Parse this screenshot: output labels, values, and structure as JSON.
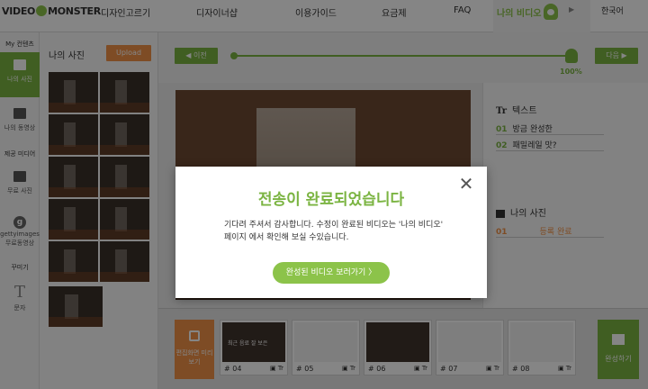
{
  "nav": {
    "logo_left": "VIDEO",
    "logo_right": "MONSTER",
    "items": [
      "디자인고르기",
      "디자이너샵",
      "이용가이드",
      "요금제",
      "FAQ"
    ],
    "my_video": "나의 비디오",
    "language": "한국어"
  },
  "tools": {
    "my_contents": "My 컨텐츠",
    "my_photo": "나의 사진",
    "my_video": "나의 동영상",
    "provided_media": "제공 미디어",
    "free_photo": "무료 사진",
    "gettyimages": "gettyimages",
    "free_video": "무료동영상",
    "decorate": "꾸미기",
    "text": "문자"
  },
  "photo_panel": {
    "title": "나의 사진",
    "upload": "Upload"
  },
  "editor": {
    "prev": "◀ 이전",
    "next": "다음 ▶",
    "progress_percent": "100%",
    "progress_value": 1.0
  },
  "right_panel": {
    "text_title": "텍스트",
    "text_rows": [
      {
        "num": "01",
        "text": "방금 완성한"
      },
      {
        "num": "02",
        "text": "패밀레일 맛?"
      }
    ],
    "photo_title": "나의 사진",
    "photo_rows": [
      {
        "num": "01",
        "status": "등록 완료"
      }
    ]
  },
  "timeline": {
    "preview": "편집화면 미리보기",
    "clips": [
      {
        "num": "# 04",
        "caption": "최근 음료 잘 보은",
        "tags": "▣ Tr",
        "light": false
      },
      {
        "num": "# 05",
        "caption": "",
        "tags": "▣ Tr",
        "light": true
      },
      {
        "num": "# 06",
        "caption": "",
        "tags": "▣ Tr",
        "light": false
      },
      {
        "num": "# 07",
        "caption": "",
        "tags": "▣ Tr",
        "light": true
      },
      {
        "num": "# 08",
        "caption": "",
        "tags": "▣ Tr",
        "light": true
      }
    ],
    "complete": "완성하기"
  },
  "modal": {
    "title": "전송이 완료되었습니다",
    "message": "기다려 주셔서 감사합니다. 수정이 완료된 비디오는 '나의 비디오' 페이지 에서 확인해 보실 수있습니다.",
    "button": "완성된 비디오 보러가기 〉",
    "close": "✕"
  },
  "colors": {
    "brand_green": "#8cc34a",
    "accent_orange": "#f29348"
  }
}
